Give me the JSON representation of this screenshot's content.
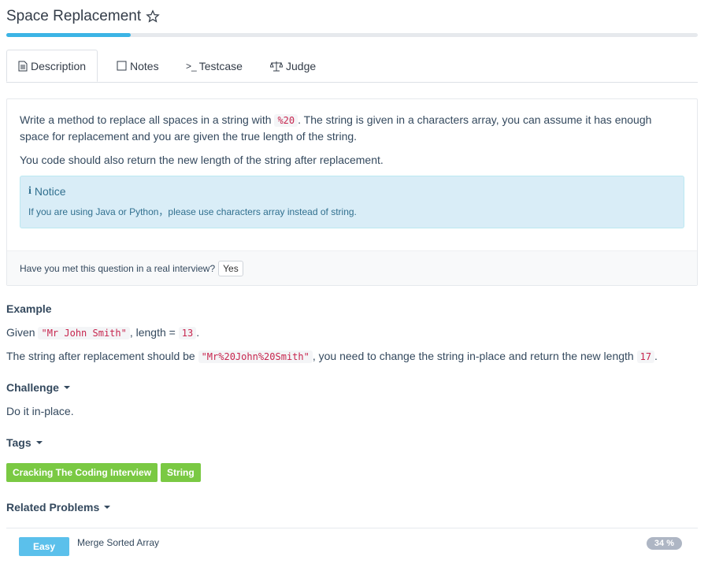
{
  "problem": {
    "title": "Space Replacement",
    "progress_pct": 18
  },
  "tabs": [
    {
      "label": "Description",
      "icon": "file-icon",
      "active": true
    },
    {
      "label": "Notes",
      "icon": "note-icon"
    },
    {
      "label": "Testcase",
      "icon": "terminal-icon"
    },
    {
      "label": "Judge",
      "icon": "scale-icon"
    }
  ],
  "description": {
    "p1_a": "Write a method to replace all spaces in a string with ",
    "p1_code": "%20",
    "p1_b": ". The string is given in a characters array, you can assume it has enough",
    "p1_c": "space for replacement and you are given the true length of the string.",
    "p2": "You code should also return the new length of the string after replacement.",
    "notice_title": "Notice",
    "notice_text": "If you are using Java or Python，please use characters array instead of string."
  },
  "interview": {
    "question": "Have you met this question in a real interview?",
    "yes_label": "Yes"
  },
  "example": {
    "heading": "Example",
    "l1_a": "Given ",
    "l1_code1": "\"Mr John Smith\"",
    "l1_b": ", length = ",
    "l1_code2": "13",
    "l1_c": ".",
    "l2_a": "The string after replacement should be ",
    "l2_code1": "\"Mr%20John%20Smith\"",
    "l2_b": ", you need to change the string in-place and return the new length ",
    "l2_code2": "17",
    "l2_c": "."
  },
  "challenge": {
    "heading": "Challenge",
    "text": "Do it in-place."
  },
  "tags_section": {
    "heading": "Tags",
    "tags": [
      "Cracking The Coding Interview",
      "String"
    ]
  },
  "related": {
    "heading": "Related Problems",
    "items": [
      {
        "difficulty": "Easy",
        "name": "Merge Sorted Array",
        "rate": "34 %"
      }
    ]
  },
  "colors": {
    "accent": "#3cb4e5",
    "tag_green": "#7ac943",
    "easy_blue": "#5bc0eb"
  }
}
